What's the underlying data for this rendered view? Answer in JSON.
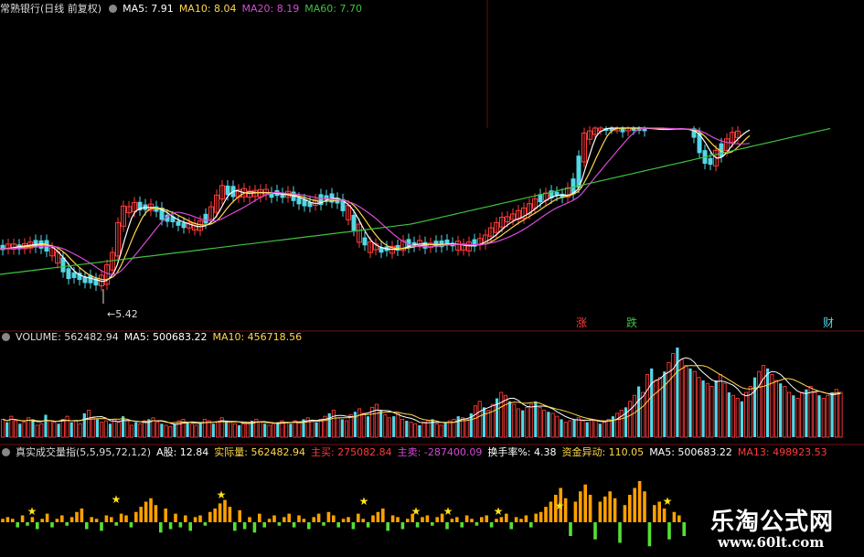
{
  "main_header": {
    "title": "常熟银行(日线 前复权)",
    "ma5": "MA5: 7.91",
    "ma10": "MA10: 8.04",
    "ma20": "MA20: 8.19",
    "ma60": "MA60: 7.70"
  },
  "volume_header": {
    "volume": "VOLUME: 562482.94",
    "ma5": "MA5: 500683.22",
    "ma10": "MA10: 456718.56"
  },
  "indicator_header": {
    "name": "真实成交量指(5,5,95,72,1,2)",
    "a_shares": "A股: 12.84",
    "actual": "实际量: 562482.94",
    "buy": "主买: 275082.84",
    "sell": "主卖: -287400.09",
    "turnover": "换手率%: 4.38",
    "fund": "资金异动: 110.05",
    "ma5": "MA5: 500683.22",
    "ma13": "MA13: 498923.53"
  },
  "annotations": {
    "low_price": "5.42",
    "up": "涨",
    "down": "跌",
    "fin": "财"
  },
  "watermark": {
    "name": "乐淘公式网",
    "url": "www.60lt.com"
  },
  "colors": {
    "up": "#ff3b3b",
    "down": "#54d7e6",
    "ma5": "#ffffff",
    "ma10": "#ffd84a",
    "ma20": "#d64bd6",
    "ma60": "#3fc23f",
    "buy_bar": "#ffa000",
    "sell_bar": "#55e035",
    "star": "#ffe21a"
  },
  "chart_data": {
    "type": "candlestick",
    "series": [
      {
        "name": "MA5",
        "values": [
          7.91
        ]
      },
      {
        "name": "MA10",
        "values": [
          8.04
        ]
      },
      {
        "name": "MA20",
        "values": [
          8.19
        ]
      },
      {
        "name": "MA60",
        "values": [
          7.7
        ]
      }
    ],
    "volume": {
      "last": 562482.94,
      "ma5": 500683.22,
      "ma10": 456718.56
    },
    "volume_bars": [
      12,
      10,
      14,
      11,
      9,
      10,
      13,
      12,
      8,
      9,
      15,
      11,
      10,
      9,
      12,
      14,
      10,
      11,
      9,
      16,
      18,
      13,
      12,
      10,
      11,
      9,
      12,
      10,
      14,
      11,
      8,
      10,
      9,
      11,
      12,
      13,
      10,
      9,
      8,
      7,
      9,
      11,
      12,
      10,
      9,
      8,
      10,
      12,
      11,
      9,
      10,
      13,
      11,
      10,
      9,
      8,
      9,
      10,
      11,
      12,
      10,
      9,
      8,
      9,
      10,
      11,
      10,
      9,
      11,
      10,
      12,
      13,
      11,
      10,
      12,
      14,
      16,
      18,
      13,
      12,
      11,
      15,
      17,
      19,
      16,
      14,
      20,
      22,
      18,
      15,
      13,
      14,
      16,
      12,
      11,
      10,
      9,
      8,
      10,
      11,
      12,
      9,
      8,
      10,
      11,
      12,
      14,
      13,
      12,
      16,
      21,
      24,
      20,
      18,
      22,
      26,
      30,
      28,
      24,
      22,
      19,
      18,
      20,
      22,
      24,
      20,
      18,
      17,
      16,
      14,
      12,
      10,
      11,
      12,
      13,
      11,
      10,
      12,
      11,
      9,
      10,
      12,
      14,
      16,
      18,
      20,
      24,
      28,
      34,
      30,
      42,
      46,
      38,
      40,
      44,
      50,
      56,
      60,
      52,
      48,
      46,
      44,
      40,
      38,
      36,
      34,
      38,
      42,
      36,
      30,
      28,
      26,
      24,
      30,
      34,
      40,
      44,
      48,
      46,
      42,
      38,
      36,
      34,
      30,
      28,
      26,
      30,
      32,
      34,
      30,
      28,
      26,
      28,
      30,
      32,
      30
    ],
    "indicator_bars": [
      2,
      3,
      2,
      -3,
      4,
      -2,
      3,
      -4,
      2,
      5,
      -3,
      2,
      4,
      -2,
      3,
      6,
      8,
      -4,
      3,
      2,
      -5,
      4,
      3,
      -2,
      5,
      4,
      -3,
      6,
      9,
      12,
      14,
      10,
      -6,
      8,
      -4,
      5,
      -3,
      4,
      -5,
      3,
      4,
      -2,
      6,
      8,
      11,
      13,
      9,
      -5,
      7,
      -4,
      3,
      -6,
      5,
      -3,
      2,
      4,
      -2,
      3,
      5,
      -3,
      4,
      2,
      -4,
      3,
      5,
      -2,
      6,
      4,
      -3,
      2,
      3,
      -4,
      5,
      2,
      -3,
      4,
      6,
      8,
      -5,
      4,
      3,
      -4,
      2,
      5,
      -3,
      3,
      4,
      -2,
      3,
      5,
      -4,
      2,
      3,
      -3,
      4,
      2,
      -2,
      3,
      4,
      -3,
      2,
      3,
      5,
      -4,
      3,
      2,
      4,
      -3,
      5,
      6,
      9,
      12,
      16,
      20,
      14,
      -8,
      12,
      18,
      22,
      16,
      -10,
      12,
      15,
      18,
      14,
      -12,
      10,
      16,
      20,
      24,
      18,
      -14,
      10,
      12,
      8,
      -10,
      6,
      4,
      -8,
      3,
      2,
      -6
    ]
  }
}
